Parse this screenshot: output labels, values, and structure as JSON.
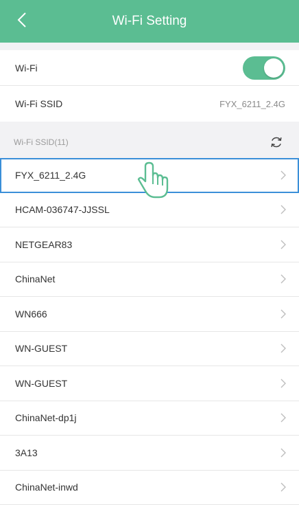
{
  "header": {
    "title": "Wi-Fi Setting",
    "back_icon": "chevron-left-icon"
  },
  "settings": {
    "wifi_label": "Wi-Fi",
    "wifi_enabled": true,
    "ssid_label": "Wi-Fi SSID",
    "ssid_value": "FYX_6211_2.4G"
  },
  "networks_section": {
    "label": "Wi-Fi SSID(11)",
    "refresh_icon": "refresh-icon"
  },
  "networks": [
    {
      "name": "FYX_6211_2.4G"
    },
    {
      "name": "HCAM-036747-JJSSL"
    },
    {
      "name": "NETGEAR83"
    },
    {
      "name": "ChinaNet"
    },
    {
      "name": "WN666"
    },
    {
      "name": "WN-GUEST"
    },
    {
      "name": "WN-GUEST"
    },
    {
      "name": "ChinaNet-dp1j"
    },
    {
      "name": "3A13"
    },
    {
      "name": "ChinaNet-inwd"
    }
  ],
  "colors": {
    "accent": "#5bbd92",
    "selection": "#3a8fd8"
  }
}
